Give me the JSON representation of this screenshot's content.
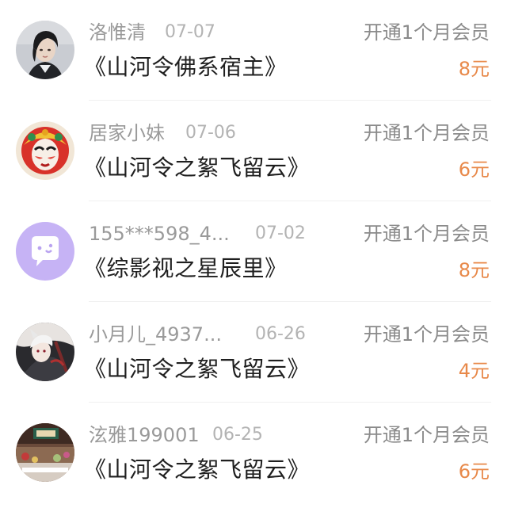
{
  "colors": {
    "price": "#e8894a",
    "username": "#9a9a9a",
    "date": "#b3b3b3",
    "title": "#1f1f1f",
    "action": "#8a8a8a",
    "divider": "#f0f0f0"
  },
  "records": [
    {
      "avatar_icon": "portrait-avatar-icon",
      "username": "洛惟清",
      "date": "07-07",
      "book_title": "《山河令佛系宿主》",
      "action": "开通1个月会员",
      "price": "8元"
    },
    {
      "avatar_icon": "opera-mask-avatar-icon",
      "username": "居家小妹",
      "date": "07-06",
      "book_title": "《山河令之絮飞留云》",
      "action": "开通1个月会员",
      "price": "6元"
    },
    {
      "avatar_icon": "chat-bubble-avatar-icon",
      "username": "155***598_4...",
      "date": "07-02",
      "book_title": "《综影视之星辰里》",
      "action": "开通1个月会员",
      "price": "8元"
    },
    {
      "avatar_icon": "anime-character-avatar-icon",
      "username": "小月儿_4937...",
      "date": "06-26",
      "book_title": "《山河令之絮飞留云》",
      "action": "开通1个月会员",
      "price": "4元"
    },
    {
      "avatar_icon": "photo-scene-avatar-icon",
      "username": "泫雅199001",
      "date": "06-25",
      "book_title": "《山河令之絮飞留云》",
      "action": "开通1个月会员",
      "price": "6元"
    }
  ]
}
